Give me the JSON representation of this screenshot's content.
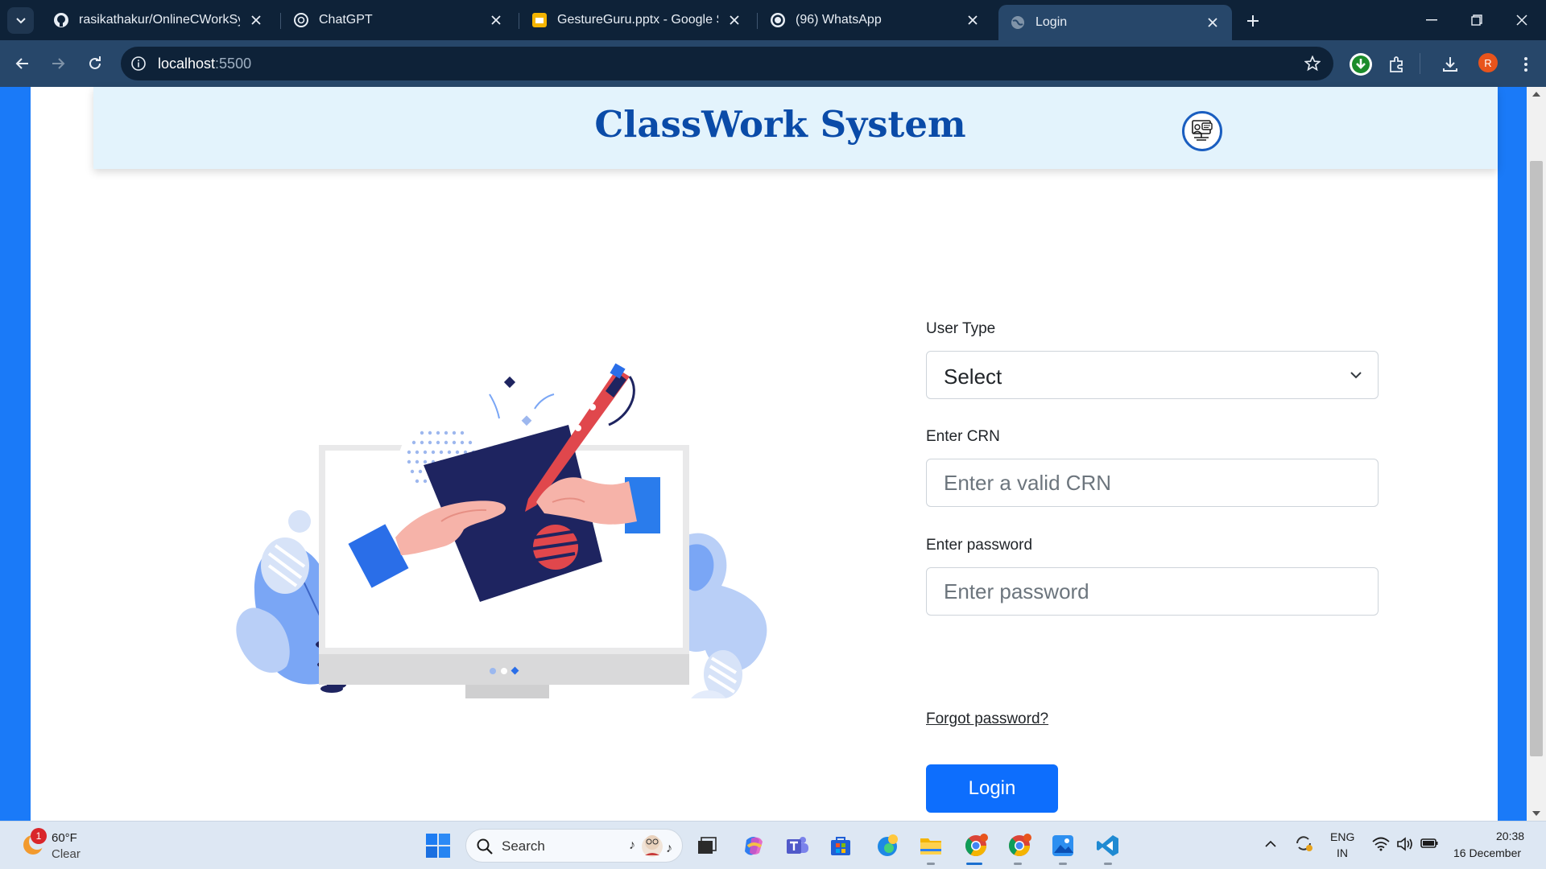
{
  "browser": {
    "tabs": [
      {
        "title": "rasikathakur/OnlineCWorkSyste",
        "icon": "github-icon",
        "active": false
      },
      {
        "title": "ChatGPT",
        "icon": "chatgpt-icon",
        "active": false
      },
      {
        "title": "GestureGuru.pptx - Google Slid",
        "icon": "google-slides-icon",
        "active": false
      },
      {
        "title": "(96) WhatsApp",
        "icon": "whatsapp-icon",
        "active": false
      },
      {
        "title": "Login",
        "icon": "globe-icon",
        "active": true
      }
    ],
    "url_host": "localhost",
    "url_port": ":5500",
    "profile_initial": "R"
  },
  "page": {
    "header_title": "ClassWork System",
    "form": {
      "user_type_label": "User Type",
      "user_type_value": "Select",
      "crn_label": "Enter CRN",
      "crn_placeholder": "Enter a valid CRN",
      "password_label": "Enter password",
      "password_placeholder": "Enter password",
      "forgot_text": "Forgot password?",
      "login_label": "Login"
    }
  },
  "taskbar": {
    "weather_badge": "1",
    "temperature": "60°F",
    "condition": "Clear",
    "search_text": "Search",
    "lang_top": "ENG",
    "lang_bottom": "IN",
    "time": "20:38",
    "date": "16 December"
  },
  "colors": {
    "brand_blue": "#0a4ba8",
    "button_blue": "#0d6efd",
    "header_bg": "#e3f3fc",
    "page_side": "#1a7af8"
  }
}
